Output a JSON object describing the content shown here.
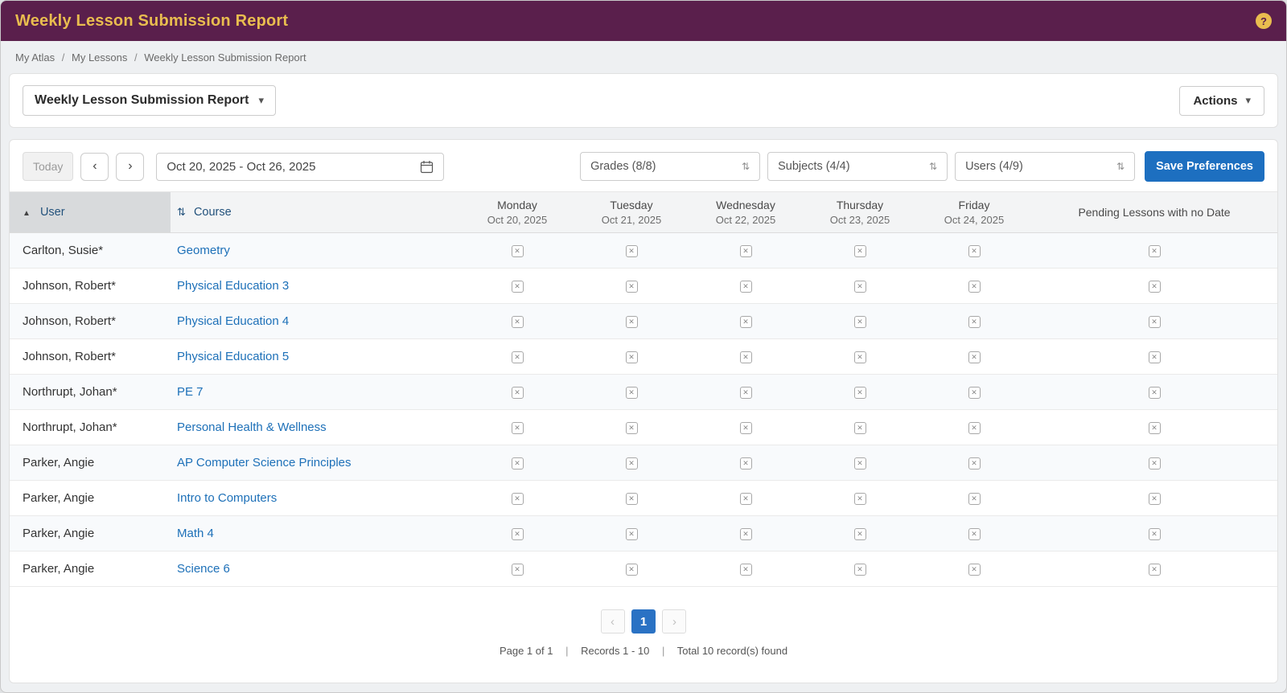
{
  "colors": {
    "header_bg": "#5a1f4c",
    "header_title": "#e9bd4f",
    "link_blue": "#1d70b8",
    "primary_button": "#1d6fc0"
  },
  "icons": {
    "help": "?",
    "caret_down": "▾",
    "chevron_left": "‹",
    "chevron_right": "›",
    "sort_asc": "▲",
    "sort_both": "⇅",
    "no_lesson": "✕"
  },
  "header": {
    "title": "Weekly Lesson Submission Report"
  },
  "breadcrumb": {
    "separator": "/",
    "items": [
      "My Atlas",
      "My Lessons",
      "Weekly Lesson Submission Report"
    ]
  },
  "report_bar": {
    "selector_label": "Weekly Lesson Submission Report",
    "actions_label": "Actions"
  },
  "toolbar": {
    "today_label": "Today",
    "date_range": "Oct 20, 2025 - Oct 26, 2025",
    "grades_filter": "Grades (8/8)",
    "subjects_filter": "Subjects (4/4)",
    "users_filter": "Users (4/9)",
    "save_preferences_label": "Save Preferences"
  },
  "table": {
    "columns": [
      {
        "label": "User"
      },
      {
        "label": "Course"
      },
      {
        "label": "Monday",
        "date": "Oct 20, 2025"
      },
      {
        "label": "Tuesday",
        "date": "Oct 21, 2025"
      },
      {
        "label": "Wednesday",
        "date": "Oct 22, 2025"
      },
      {
        "label": "Thursday",
        "date": "Oct 23, 2025"
      },
      {
        "label": "Friday",
        "date": "Oct 24, 2025"
      },
      {
        "label": "Pending Lessons with no Date"
      }
    ],
    "rows": [
      {
        "user": "Carlton, Susie*",
        "course": "Geometry"
      },
      {
        "user": "Johnson, Robert*",
        "course": "Physical Education 3"
      },
      {
        "user": "Johnson, Robert*",
        "course": "Physical Education 4"
      },
      {
        "user": "Johnson, Robert*",
        "course": "Physical Education 5"
      },
      {
        "user": "Northrupt, Johan*",
        "course": "PE 7"
      },
      {
        "user": "Northrupt, Johan*",
        "course": "Personal Health & Wellness"
      },
      {
        "user": "Parker, Angie",
        "course": "AP Computer Science Principles"
      },
      {
        "user": "Parker, Angie",
        "course": "Intro to Computers"
      },
      {
        "user": "Parker, Angie",
        "course": "Math 4"
      },
      {
        "user": "Parker, Angie",
        "course": "Science 6"
      }
    ]
  },
  "pagination": {
    "page": "1",
    "summary_page": "Page 1 of 1",
    "summary_records": "Records 1 - 10",
    "summary_total": "Total 10 record(s) found",
    "separator": "|"
  }
}
